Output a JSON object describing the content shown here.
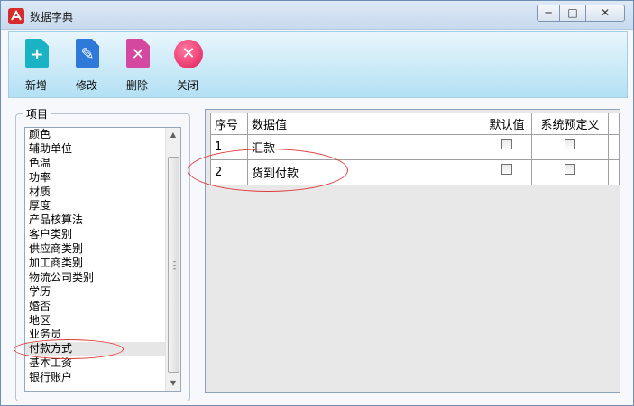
{
  "window": {
    "title": "数据字典"
  },
  "titlebar": {
    "min": "─",
    "max": "□",
    "close": "✕"
  },
  "toolbar": {
    "add": {
      "label": "新增",
      "icon": "add-doc-icon",
      "color": "#19b3c5",
      "symbol": "+"
    },
    "edit": {
      "label": "修改",
      "icon": "edit-doc-icon",
      "color": "#2f79d8",
      "symbol": "✎"
    },
    "delete": {
      "label": "删除",
      "icon": "delete-doc-icon",
      "color": "#d4499f",
      "symbol": "✕"
    },
    "close": {
      "label": "关闭",
      "icon": "close-circle-icon",
      "color": "#e01d5a",
      "symbol": "✕"
    }
  },
  "items_panel": {
    "label": "项目",
    "items": [
      "颜色",
      "辅助单位",
      "色温",
      "功率",
      "材质",
      "厚度",
      "产品核算法",
      "客户类别",
      "供应商类别",
      "加工商类别",
      "物流公司类别",
      "学历",
      "婚否",
      "地区",
      "业务员",
      "付款方式",
      "基本工资",
      "银行账户"
    ],
    "selected_index": 15
  },
  "grid": {
    "columns": [
      "序号",
      "数据值",
      "默认值",
      "系统预定义"
    ],
    "rows": [
      {
        "index": "1",
        "value": "汇款",
        "default_checked": false,
        "predefined_checked": false
      },
      {
        "index": "2",
        "value": "货到付款",
        "default_checked": false,
        "predefined_checked": false
      }
    ]
  }
}
